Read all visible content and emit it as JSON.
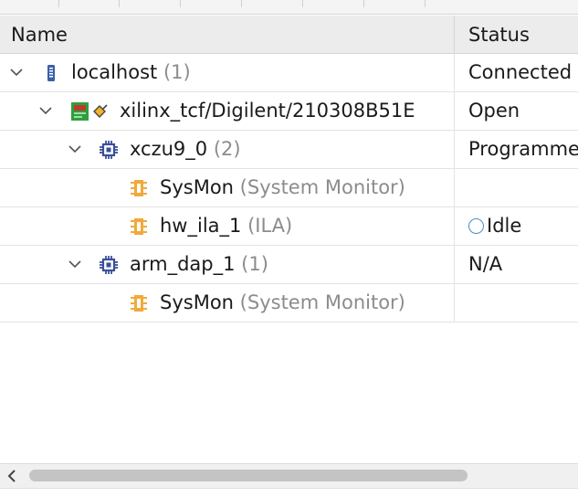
{
  "header": {
    "name": "Name",
    "status": "Status"
  },
  "rows": [
    {
      "name": "localhost",
      "extra": "(1)",
      "status": "Connected",
      "icon": "server-icon"
    },
    {
      "name": "xilinx_tcf/Digilent/210308B51E",
      "extra": "",
      "status": "Open",
      "icon": "jtag-cable-icon"
    },
    {
      "name": "xczu9_0",
      "extra": "(2)",
      "status": "Programmed",
      "icon": "chip-icon"
    },
    {
      "name": "SysMon",
      "extra": "(System Monitor)",
      "status": "",
      "icon": "debug-core-icon"
    },
    {
      "name": "hw_ila_1",
      "extra": "(ILA)",
      "status": "Idle",
      "icon": "debug-core-icon"
    },
    {
      "name": "arm_dap_1",
      "extra": "(1)",
      "status": "N/A",
      "icon": "chip-icon"
    },
    {
      "name": "SysMon",
      "extra": "(System Monitor)",
      "status": "",
      "icon": "debug-core-icon"
    }
  ]
}
